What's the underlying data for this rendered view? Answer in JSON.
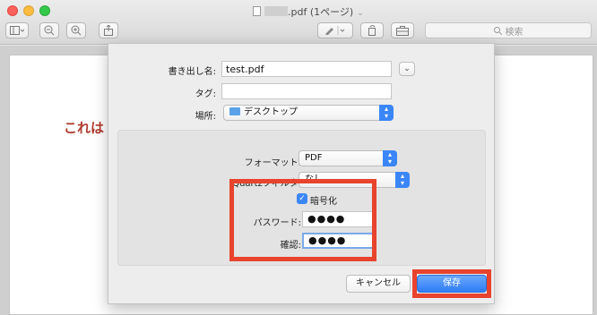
{
  "window": {
    "title": ".pdf (1ページ)"
  },
  "toolbar": {
    "search_placeholder": "検索"
  },
  "page": {
    "text": "これは"
  },
  "dialog": {
    "export_as_label": "書き出し名:",
    "export_as_value": "test.pdf",
    "tags_label": "タグ:",
    "tags_value": "",
    "where_label": "場所:",
    "where_value": "デスクトップ",
    "format_label": "フォーマット:",
    "format_value": "PDF",
    "quartz_filter_label": "Quartzフィルタ:",
    "quartz_filter_value": "なし",
    "encrypt_label": "暗号化",
    "encrypt_checked": true,
    "password_label": "パスワード:",
    "password_value": "●●●●",
    "verify_label": "確認:",
    "verify_value": "●●●●",
    "cancel_label": "キャンセル",
    "save_label": "保存"
  },
  "colors": {
    "highlight": "#e8432d",
    "accent": "#3b86f7",
    "page_text": "#b03a2e"
  }
}
